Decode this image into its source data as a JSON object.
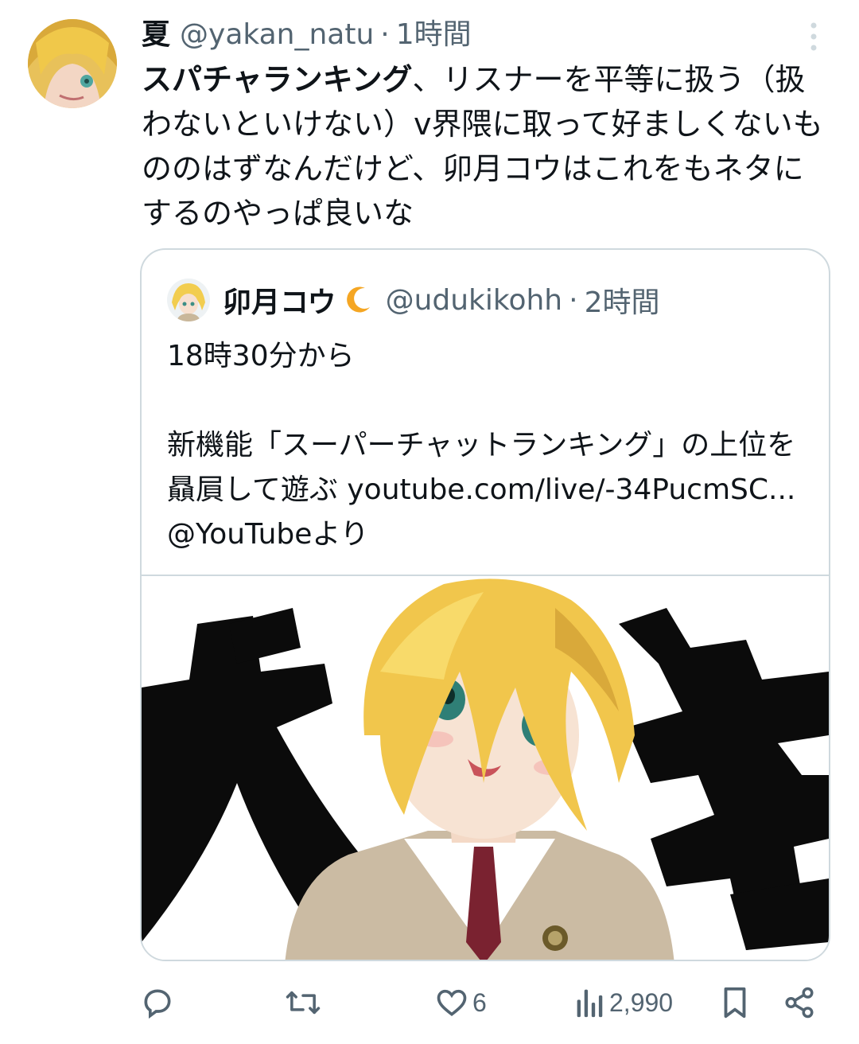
{
  "tweet": {
    "author_name": "夏",
    "author_handle": "@yakan_natu",
    "separator": "·",
    "time": "1時間",
    "text_bold": "スパチャランキング",
    "text_rest": "、リスナーを平等に扱う（扱わないといけない）v界隈に取って好ましくないもののはずなんだけど、卯月コウはこれをもネタにするのやっぱ良いな"
  },
  "quote": {
    "author_name": "卯月コウ",
    "author_handle": "@udukikohh",
    "separator": "·",
    "time": "2時間",
    "text": "18時30分から\n\n新機能「スーパーチャットランキング」の上位を贔屓して遊ぶ youtube.com/live/-34PucmSC... @YouTubeより"
  },
  "actions": {
    "reply_count": "",
    "retweet_count": "",
    "like_count": "6",
    "views_count": "2,990"
  },
  "icons": {
    "more": "more-vertical-icon",
    "moon": "crescent-moon-icon",
    "reply": "reply-icon",
    "retweet": "retweet-icon",
    "like": "heart-icon",
    "views": "views-chart-icon",
    "bookmark": "bookmark-icon",
    "share": "share-icon"
  },
  "colors": {
    "text": "#0f1419",
    "secondary": "#536471",
    "border": "#cfd9de",
    "moon": "#f5a623"
  }
}
